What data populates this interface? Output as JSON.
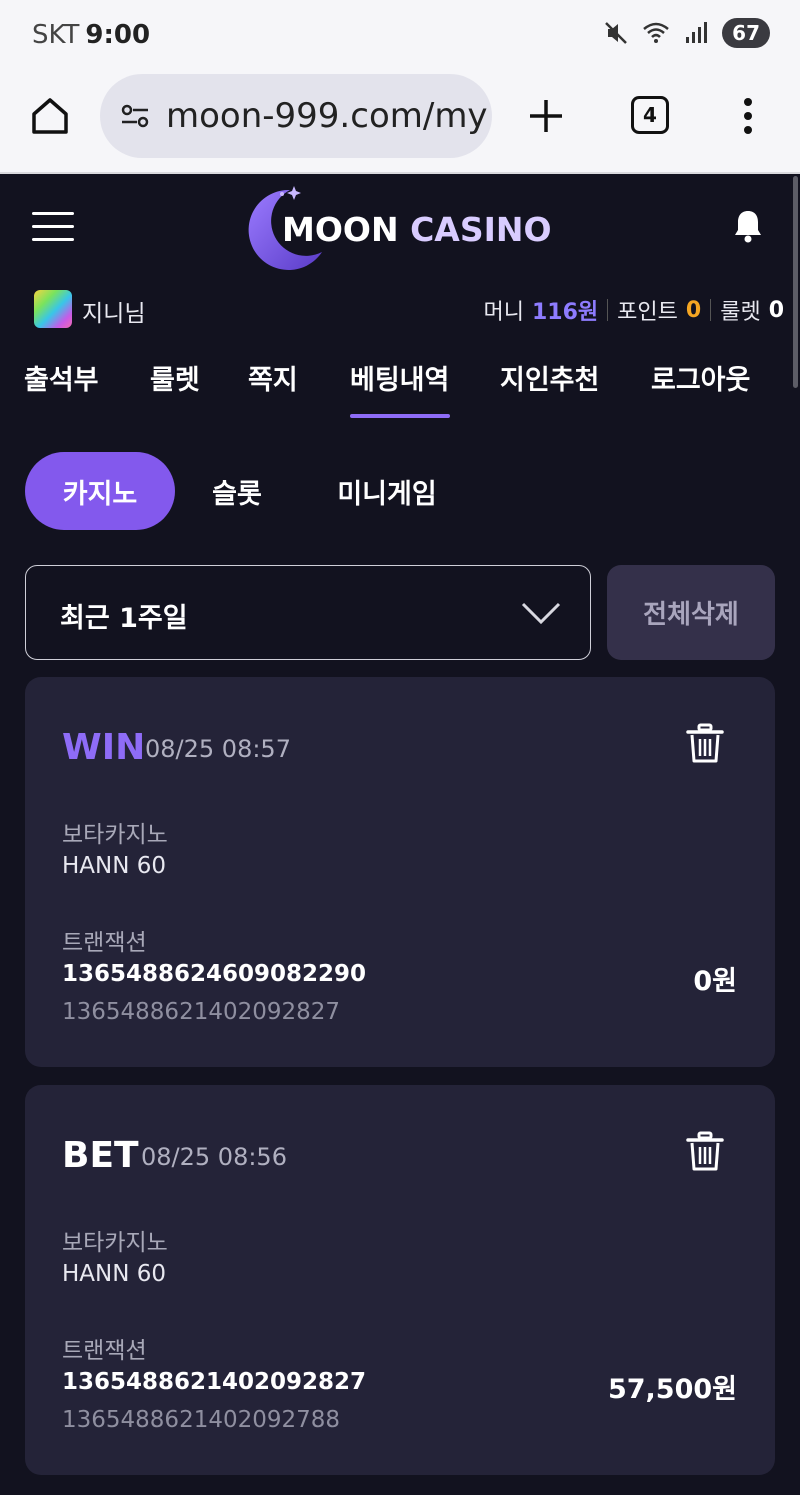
{
  "status_bar": {
    "carrier": "SKT",
    "time": "9:00",
    "battery": "67"
  },
  "browser": {
    "url": "moon-999.com/my",
    "tab_count": "4"
  },
  "brand": {
    "logo_word1": "MOON",
    "logo_word2": "CASINO",
    "accent": "#8359ed"
  },
  "user": {
    "name": "지니님",
    "money_label": "머니",
    "money_value": "116원",
    "point_label": "포인트",
    "point_value": "0",
    "roulette_label": "룰렛",
    "roulette_value": "0"
  },
  "nav": {
    "items": [
      "출석부",
      "룰렛",
      "쪽지",
      "베팅내역",
      "지인추천",
      "로그아웃"
    ],
    "active": "베팅내역"
  },
  "game_tabs": {
    "items": [
      "카지노",
      "슬롯",
      "미니게임"
    ],
    "active": "카지노"
  },
  "filter": {
    "period": "최근 1주일",
    "delete_all": "전체삭제"
  },
  "bets": [
    {
      "status": "WIN",
      "status_color": "#8e6cf7",
      "datetime": "08/25 08:57",
      "provider": "보타카지노",
      "game": "HANN 60",
      "tx_label": "트랜잭션",
      "tx_id": "1365488624609082290",
      "tx_ref": "1365488621402092827",
      "amount": "0원"
    },
    {
      "status": "BET",
      "status_color": "#ffffff",
      "datetime": "08/25 08:56",
      "provider": "보타카지노",
      "game": "HANN 60",
      "tx_label": "트랜잭션",
      "tx_id": "1365488621402092827",
      "tx_ref": "1365488621402092788",
      "amount": "57,500원"
    }
  ]
}
